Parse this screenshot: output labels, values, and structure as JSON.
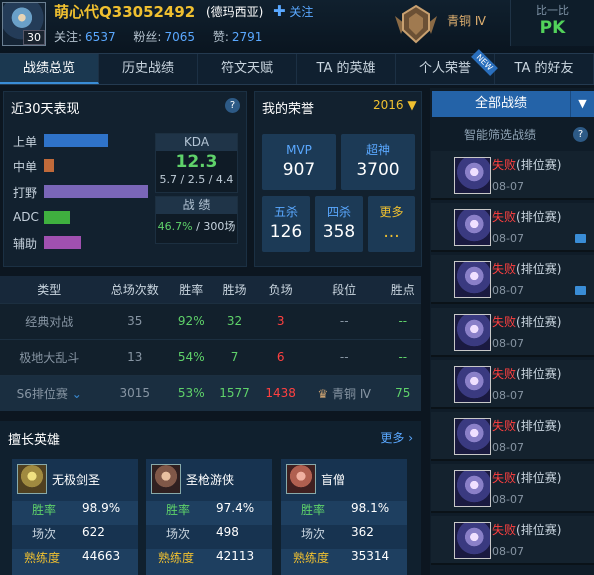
{
  "header": {
    "player_name": "萌心代Q33052492",
    "server": "(德玛西亚)",
    "follow_label": "关注",
    "level": "30",
    "stats": [
      {
        "label": "关注:",
        "value": "6537"
      },
      {
        "label": "粉丝:",
        "value": "7065"
      },
      {
        "label": "赞:",
        "value": "2791"
      }
    ],
    "rank_tier": "青铜 Ⅳ",
    "compare_label": "比一比",
    "pk_label": "PK"
  },
  "tabs": [
    "战绩总览",
    "历史战绩",
    "符文天赋",
    "TA 的英雄",
    "个人荣誉",
    "TA 的好友"
  ],
  "new_badge": "NEW",
  "recent": {
    "title": "近30天表现",
    "help": "?",
    "roles": [
      {
        "label": "上单",
        "color": "#2f73c9",
        "value": 0.62
      },
      {
        "label": "中单",
        "color": "#c06a3a",
        "value": 0.1
      },
      {
        "label": "打野",
        "color": "#7a66b8",
        "value": 1.0
      },
      {
        "label": "ADC",
        "color": "#3fb03f",
        "value": 0.25
      },
      {
        "label": "辅助",
        "color": "#a050b0",
        "value": 0.36
      }
    ],
    "kda_title": "KDA",
    "kda_value": "12.3",
    "kda_detail": "5.7 / 2.5 / 4.4",
    "record_title": "战 绩",
    "winrate": "46.7%",
    "games": "/ 300场"
  },
  "honor": {
    "title": "我的荣誉",
    "year": "2016",
    "cells": [
      {
        "label": "MVP",
        "value": "907"
      },
      {
        "label": "超神",
        "value": "3700"
      },
      {
        "label": "五杀",
        "value": "126"
      },
      {
        "label": "四杀",
        "value": "358"
      },
      {
        "label": "更多",
        "value": "..."
      }
    ]
  },
  "table": {
    "headers": [
      "类型",
      "总场次数",
      "胜率",
      "胜场",
      "负场",
      "段位",
      "胜点"
    ],
    "rows": [
      [
        "经典对战",
        "35",
        "92%",
        "32",
        "3",
        "--",
        "--"
      ],
      [
        "极地大乱斗",
        "13",
        "54%",
        "7",
        "6",
        "--",
        "--"
      ],
      [
        "S6排位赛",
        "3015",
        "53%",
        "1577",
        "1438",
        "青铜 Ⅳ",
        "75"
      ]
    ]
  },
  "champs": {
    "title": "擅长英雄",
    "more": "更多",
    "row_labels": [
      "胜率",
      "场次",
      "熟练度"
    ],
    "list": [
      {
        "name": "无极剑圣",
        "winrate": "98.9%",
        "games": "622",
        "mastery": "44663"
      },
      {
        "name": "圣枪游侠",
        "winrate": "97.4%",
        "games": "498",
        "mastery": "42113"
      },
      {
        "name": "盲僧",
        "winrate": "98.1%",
        "games": "362",
        "mastery": "35314"
      }
    ]
  },
  "right": {
    "all_games": "全部战绩",
    "smart_filter": "智能筛选战绩",
    "matches": [
      {
        "result": "失败",
        "queue": "(排位赛)",
        "date": "08-07",
        "video": false
      },
      {
        "result": "失败",
        "queue": "(排位赛)",
        "date": "08-07",
        "video": true
      },
      {
        "result": "失败",
        "queue": "(排位赛)",
        "date": "08-07",
        "video": true
      },
      {
        "result": "失败",
        "queue": "(排位赛)",
        "date": "08-07",
        "video": false
      },
      {
        "result": "失败",
        "queue": "(排位赛)",
        "date": "08-07",
        "video": false
      },
      {
        "result": "失败",
        "queue": "(排位赛)",
        "date": "08-07",
        "video": false
      },
      {
        "result": "失败",
        "queue": "(排位赛)",
        "date": "08-07",
        "video": false
      },
      {
        "result": "失败",
        "queue": "(排位赛)",
        "date": "08-07",
        "video": false
      }
    ]
  }
}
